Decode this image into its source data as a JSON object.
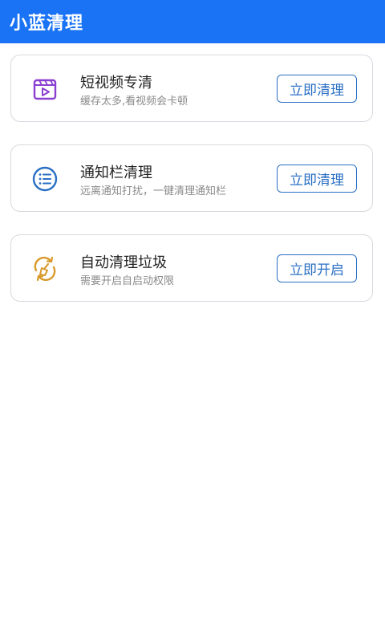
{
  "app": {
    "title": "小蓝清理"
  },
  "cards": [
    {
      "title": "短视频专清",
      "subtitle": "缓存太多,看视频会卡顿",
      "action": "立即清理",
      "icon": "video-icon",
      "icon_color": "#8b3fd0"
    },
    {
      "title": "通知栏清理",
      "subtitle": "远离通知打扰，一键清理通知栏",
      "action": "立即清理",
      "icon": "notification-list-icon",
      "icon_color": "#2a6fc4"
    },
    {
      "title": "自动清理垃圾",
      "subtitle": "需要开启自启动权限",
      "action": "立即开启",
      "icon": "auto-clean-broom-icon",
      "icon_color": "#d99a2b"
    }
  ],
  "colors": {
    "app_bar": "#1a73f5",
    "button_border": "#2a6fc4"
  }
}
